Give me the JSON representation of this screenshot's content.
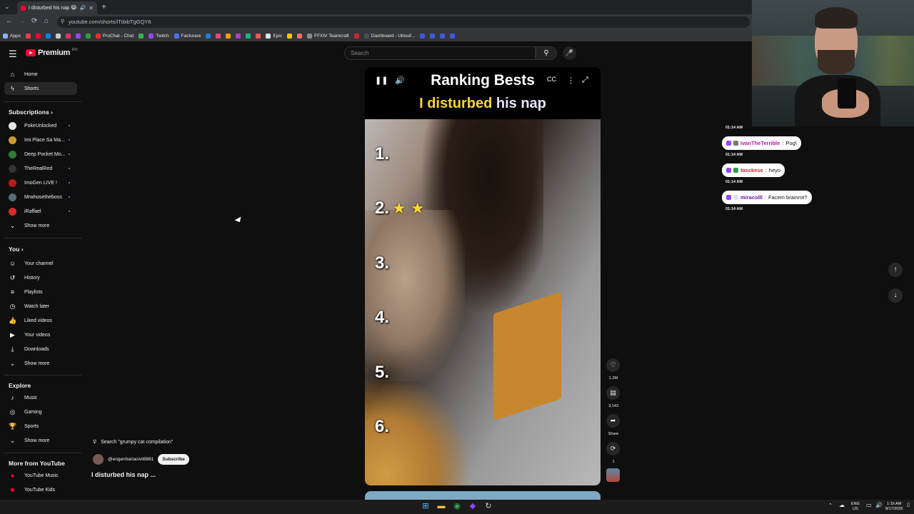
{
  "browser": {
    "tab_title": "I disturbed his nap 😹#cat",
    "url": "youtube.com/shorts/iTdxbTgGQY8",
    "apps_label": "Apps",
    "bookmarks": [
      "ProChat - Chat",
      "Twitch",
      "Facturare",
      "Epic",
      "FFXIV Teamcraft",
      "Dashboard - Ubisof..."
    ]
  },
  "youtube": {
    "logo_word": "Premium",
    "logo_badge": "RO",
    "search_placeholder": "Search"
  },
  "sidebar": {
    "main": [
      {
        "label": "Home",
        "icon": "home-icon"
      },
      {
        "label": "Shorts",
        "icon": "shorts-icon"
      }
    ],
    "subscriptions_title": "Subscriptions",
    "subscriptions": [
      {
        "label": "PokeUnlocked",
        "color": "#e6e6e6"
      },
      {
        "label": "Imi Place Sa Ma...",
        "color": "#c99a2e"
      },
      {
        "label": "Deep Pocket Mo...",
        "color": "#2e7d32"
      },
      {
        "label": "TheRealRed",
        "color": "#333333"
      },
      {
        "label": "ImoGen LIVE !",
        "color": "#b71c1c"
      },
      {
        "label": "Mrwhosetheboss",
        "color": "#546e7a"
      },
      {
        "label": "iRaffael",
        "color": "#d32f2f"
      }
    ],
    "show_more": "Show more",
    "you_title": "You",
    "you": [
      {
        "label": "Your channel",
        "icon": "user-icon"
      },
      {
        "label": "History",
        "icon": "history-icon"
      },
      {
        "label": "Playlists",
        "icon": "playlist-icon"
      },
      {
        "label": "Watch later",
        "icon": "clock-icon"
      },
      {
        "label": "Liked videos",
        "icon": "thumbs-up-icon"
      },
      {
        "label": "Your videos",
        "icon": "video-icon"
      },
      {
        "label": "Downloads",
        "icon": "download-icon"
      }
    ],
    "explore_title": "Explore",
    "explore": [
      {
        "label": "Music",
        "icon": "music-icon"
      },
      {
        "label": "Gaming",
        "icon": "gaming-icon"
      },
      {
        "label": "Sports",
        "icon": "trophy-icon"
      }
    ],
    "more_title": "More from YouTube",
    "more": [
      {
        "label": "YouTube Music"
      },
      {
        "label": "YouTube Kids"
      }
    ]
  },
  "short": {
    "overlay_title": "Ranking Bests",
    "overlay_sub_yellow": "I disturbed",
    "overlay_sub_white": "his nap",
    "ranks": [
      "1.",
      "2.",
      "3.",
      "4.",
      "5.",
      "6."
    ],
    "rank2_stars": "★ ★",
    "search_suggestion": "Search \"grumpy cat compilation\"",
    "channel": "@engenhariacivil8861",
    "subscribe_label": "Subscribe",
    "title": "I disturbed his nap ...",
    "likes": "1.2M",
    "comments": "3,143",
    "share_label": "Share",
    "remix_count": "1"
  },
  "chat": {
    "messages": [
      {
        "time": "01:14 AM",
        "user": "IvanTheTerrible",
        "user_color": "#b5179e",
        "text": "Pog\\"
      },
      {
        "time": "01:14 AM",
        "user": "tasckese",
        "user_color": "#c62828",
        "text": "heyo"
      },
      {
        "time": "01:14 AM",
        "user": "miracolll",
        "user_color": "#6a1b9a",
        "text": "Facem brainrot?"
      }
    ],
    "trailing_time": "01:14 AM"
  },
  "taskbar": {
    "lang": "ENG",
    "region": "US",
    "time": "1:16 AM",
    "date": "8/17/2026"
  }
}
